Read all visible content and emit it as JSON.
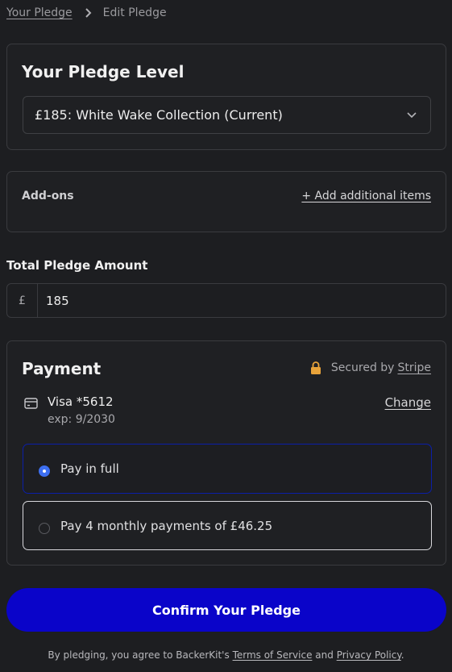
{
  "breadcrumb": {
    "parent": "Your Pledge",
    "current": "Edit Pledge"
  },
  "pledge_level": {
    "title": "Your Pledge Level",
    "selected": "£185: White Wake Collection (Current)"
  },
  "addons": {
    "title": "Add-ons",
    "link": "+ Add additional items"
  },
  "total": {
    "label": "Total Pledge Amount",
    "currency": "£",
    "value": "185"
  },
  "payment": {
    "title": "Payment",
    "secured_prefix": "Secured by",
    "secured_link": "Stripe",
    "card_brand": "Visa *5612",
    "card_exp": "exp: 9/2030",
    "change": "Change",
    "options": [
      {
        "label": "Pay in full",
        "selected": true
      },
      {
        "label": "Pay 4 monthly payments of £46.25",
        "selected": false
      }
    ]
  },
  "confirm_label": "Confirm Your Pledge",
  "legal": {
    "prefix": "By pledging, you agree to BackerKit's",
    "terms": "Terms of Service",
    "and": "and",
    "privacy": "Privacy Policy",
    "suffix": "."
  },
  "colors": {
    "background": "#1d1e21",
    "accent": "#0a04c9",
    "selected_border": "#0b1fa8",
    "radio": "#3d6ff1",
    "lock": "#e8a33a"
  },
  "icons": [
    "chevron-right-icon",
    "chevron-down-icon",
    "lock-icon",
    "credit-card-icon"
  ]
}
